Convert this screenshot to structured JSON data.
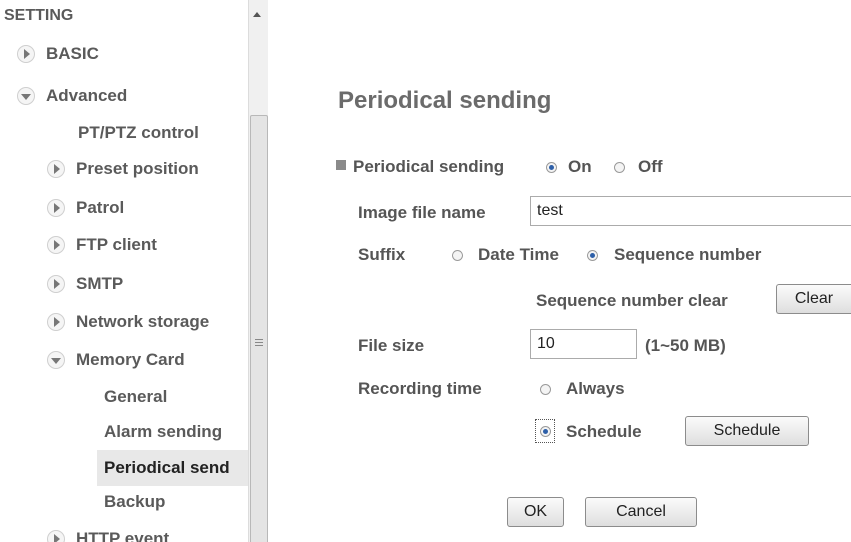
{
  "sidebar": {
    "setting_label": "SETTING",
    "basic": {
      "label": "BASIC",
      "icon": "expand-arrow-icon"
    },
    "advanced": {
      "label": "Advanced",
      "icon": "collapse-arrow-icon"
    },
    "ptz_control": "PT/PTZ control",
    "preset_position": "Preset position",
    "patrol": "Patrol",
    "ftp_client": "FTP client",
    "smtp": "SMTP",
    "network_storage": "Network storage",
    "memory_card": "Memory Card",
    "general": "General",
    "alarm_sending": "Alarm sending",
    "periodical_sending": "Periodical send",
    "backup": "Backup",
    "http_event": "HTTP event"
  },
  "main": {
    "title": "Periodical sending",
    "periodical_label": "Periodical sending",
    "on_label": "On",
    "off_label": "Off",
    "periodical_value": "On",
    "image_file_label": "Image file name",
    "image_file_value": "test",
    "suffix_label": "Suffix",
    "date_time_label": "Date Time",
    "sequence_label": "Sequence number",
    "suffix_value": "Sequence number",
    "seq_clear_label": "Sequence number clear",
    "clear_button": "Clear",
    "file_size_label": "File size",
    "file_size_value": "10",
    "file_size_range": "(1~50 MB)",
    "recording_time_label": "Recording time",
    "always_label": "Always",
    "schedule_label": "Schedule",
    "recording_value": "Schedule",
    "schedule_button": "Schedule",
    "ok_button": "OK",
    "cancel_button": "Cancel"
  },
  "colors": {
    "radio_selected": "#2d5fa8",
    "selected_row_bg": "#e8e8e8",
    "text": "#555555"
  }
}
